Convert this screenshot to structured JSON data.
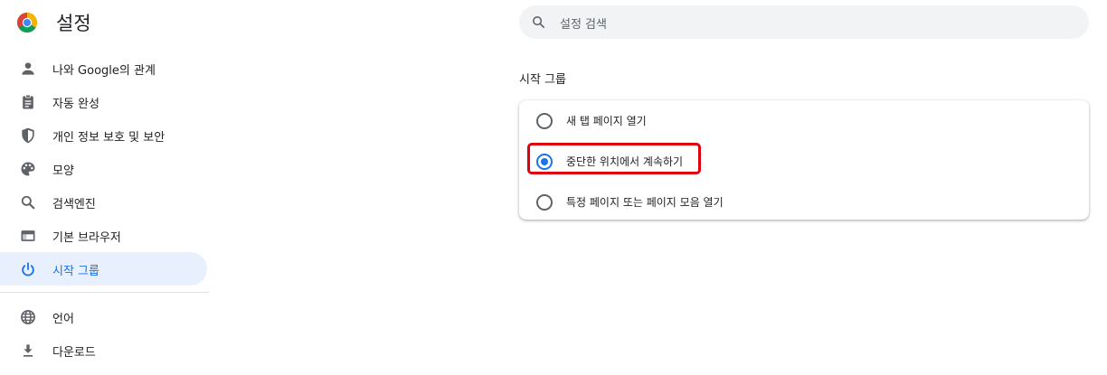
{
  "header": {
    "title": "설정"
  },
  "search": {
    "placeholder": "설정 검색"
  },
  "sidebar": {
    "items": [
      {
        "label": "나와 Google의 관계",
        "icon": "person-icon"
      },
      {
        "label": "자동 완성",
        "icon": "clipboard-icon"
      },
      {
        "label": "개인 정보 보호 및 보안",
        "icon": "shield-icon"
      },
      {
        "label": "모양",
        "icon": "palette-icon"
      },
      {
        "label": "검색엔진",
        "icon": "search-icon"
      },
      {
        "label": "기본 브라우저",
        "icon": "browser-window-icon"
      },
      {
        "label": "시작 그룹",
        "icon": "power-icon",
        "active": true
      },
      {
        "label": "언어",
        "icon": "globe-icon"
      },
      {
        "label": "다운로드",
        "icon": "download-icon"
      }
    ]
  },
  "main": {
    "section_title": "시작 그룹",
    "options": [
      {
        "label": "새 탭 페이지 열기",
        "selected": false
      },
      {
        "label": "중단한 위치에서 계속하기",
        "selected": true
      },
      {
        "label": "특정 페이지 또는 페이지 모음 열기",
        "selected": false
      }
    ]
  },
  "colors": {
    "accent": "#1a73e8",
    "active_bg": "#e8f0fe",
    "highlight_border": "#e0000b"
  }
}
